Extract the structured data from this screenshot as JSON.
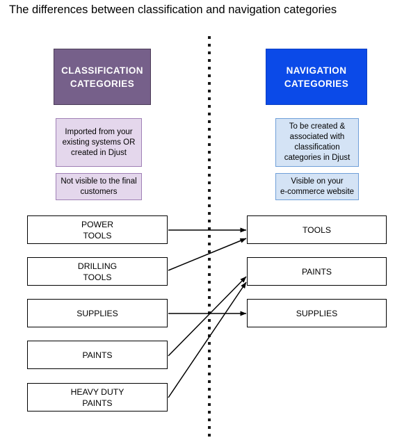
{
  "title": "The differences between classification and navigation categories",
  "divider": {
    "style": "vertical-dotted-line",
    "color": "#1a1a1a"
  },
  "colors": {
    "classification_header_bg": "#76608a",
    "navigation_header_bg": "#0b4ae8",
    "classification_note_bg": "#e4d7ec",
    "classification_note_border": "#9f7fb5",
    "navigation_note_bg": "#d4e3f5",
    "navigation_note_border": "#6f9fd8",
    "category_box_border": "#000000",
    "arrow_color": "#000000",
    "text_color": "#000000",
    "header_text_color": "#ffffff"
  },
  "left_column": {
    "header": "CLASSIFICATION\nCATEGORIES",
    "notes": [
      "Imported from your\nexisting systems OR\ncreated in Djust",
      "Not visible to the final\ncustomers"
    ],
    "categories": [
      "POWER\nTOOLS",
      "DRILLING\nTOOLS",
      "SUPPLIES",
      "PAINTS",
      "HEAVY DUTY\nPAINTS"
    ]
  },
  "right_column": {
    "header": "NAVIGATION\nCATEGORIES",
    "notes": [
      "To be created &\nassociated with\nclassification\ncategories in Djust",
      "Visible on your\ne-commerce website"
    ],
    "categories": [
      "TOOLS",
      "PAINTS",
      "SUPPLIES"
    ]
  },
  "connections": [
    {
      "from": "POWER TOOLS",
      "to": "TOOLS"
    },
    {
      "from": "DRILLING TOOLS",
      "to": "TOOLS"
    },
    {
      "from": "SUPPLIES",
      "to": "SUPPLIES"
    },
    {
      "from": "PAINTS",
      "to": "PAINTS"
    },
    {
      "from": "HEAVY DUTY PAINTS",
      "to": "PAINTS"
    }
  ]
}
